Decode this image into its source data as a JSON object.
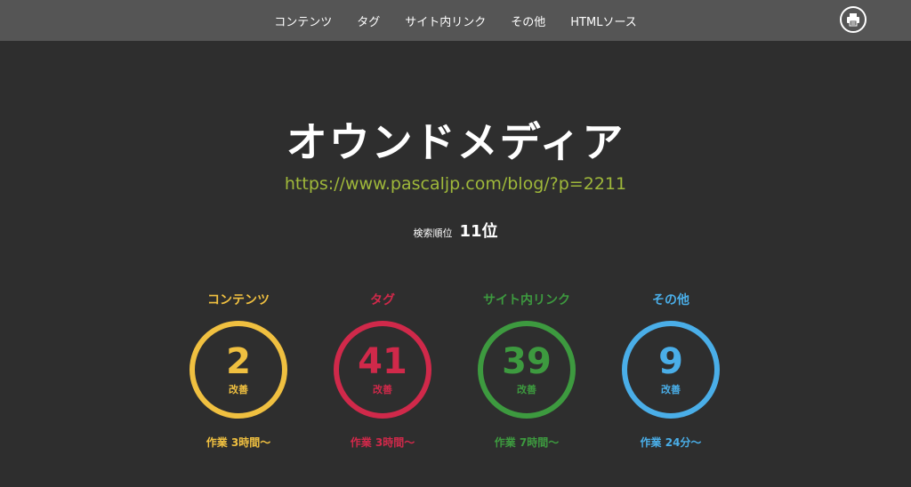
{
  "nav": {
    "items": [
      "コンテンツ",
      "タグ",
      "サイト内リンク",
      "その他",
      "HTMLソース"
    ]
  },
  "print_icon": "printer-icon",
  "title": "オウンドメディア",
  "url": "https://www.pascaljp.com/blog/?p=2211",
  "rank": {
    "label": "検索順位",
    "value": "11位"
  },
  "metrics": [
    {
      "label": "コンテンツ",
      "count": "2",
      "sub": "改善",
      "work": "作業 3時間〜",
      "color": "#f0c040"
    },
    {
      "label": "タグ",
      "count": "41",
      "sub": "改善",
      "work": "作業 3時間〜",
      "color": "#d0294a"
    },
    {
      "label": "サイト内リンク",
      "count": "39",
      "sub": "改善",
      "work": "作業 7時間〜",
      "color": "#3d9a3f"
    },
    {
      "label": "その他",
      "count": "9",
      "sub": "改善",
      "work": "作業 24分〜",
      "color": "#4aaee8"
    }
  ]
}
